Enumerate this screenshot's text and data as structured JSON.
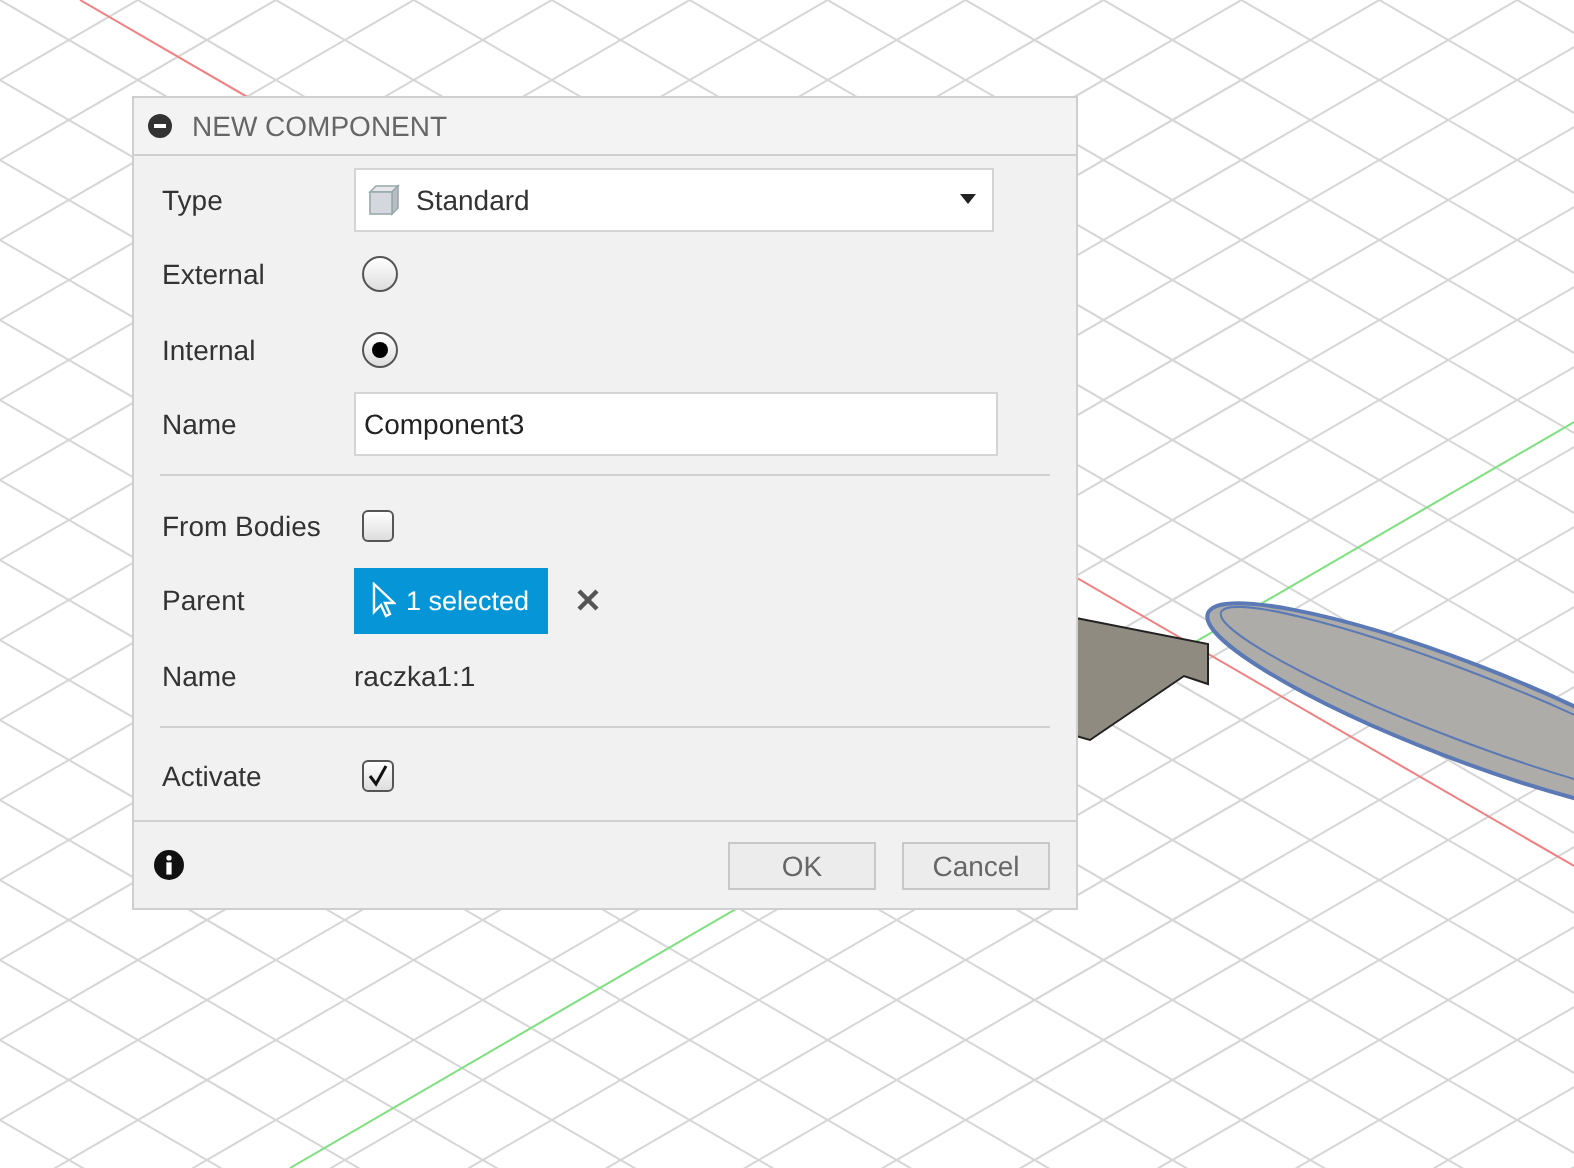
{
  "dialog": {
    "title": "NEW COMPONENT",
    "rows": [
      {
        "kind": "dropdown",
        "label": "Type",
        "value": "Standard"
      },
      {
        "kind": "radio",
        "label": "External",
        "selected": false
      },
      {
        "kind": "radio",
        "label": "Internal",
        "selected": true
      },
      {
        "kind": "text",
        "label": "Name",
        "value": "Component3"
      },
      {
        "kind": "divider"
      },
      {
        "kind": "checkbox",
        "label": "From Bodies",
        "checked": false
      },
      {
        "kind": "selection",
        "label": "Parent",
        "value": "1 selected"
      },
      {
        "kind": "static",
        "label": "Name",
        "value": "raczka1:1"
      },
      {
        "kind": "divider"
      },
      {
        "kind": "checkbox",
        "label": "Activate",
        "checked": true
      }
    ],
    "buttons": [
      "OK",
      "Cancel"
    ]
  }
}
